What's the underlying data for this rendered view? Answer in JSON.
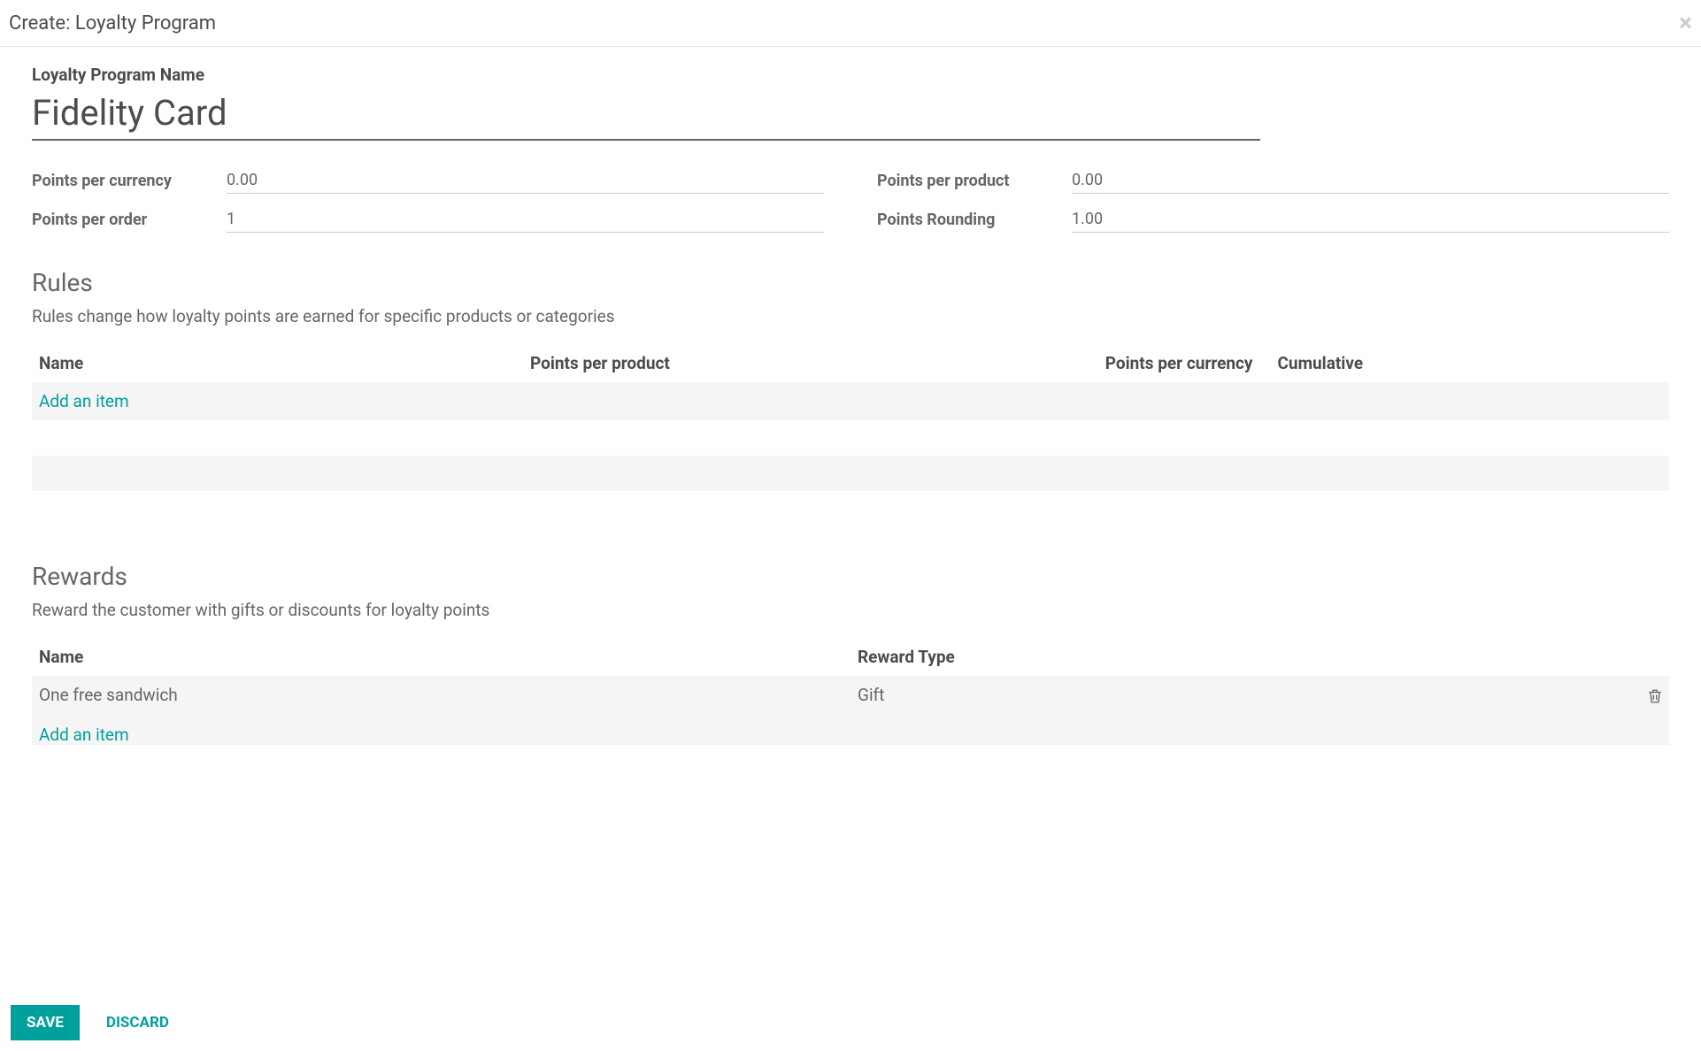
{
  "modal": {
    "title": "Create: Loyalty Program",
    "close_label": "×"
  },
  "form": {
    "name_label": "Loyalty Program Name",
    "name_value": "Fidelity Card",
    "fields": {
      "points_per_currency": {
        "label": "Points per currency",
        "value": "0.00"
      },
      "points_per_order": {
        "label": "Points per order",
        "value": "1"
      },
      "points_per_product": {
        "label": "Points per product",
        "value": "0.00"
      },
      "points_rounding": {
        "label": "Points Rounding",
        "value": "1.00"
      }
    }
  },
  "rules_section": {
    "title": "Rules",
    "desc": "Rules change how loyalty points are earned for specific products or categories",
    "columns": {
      "name": "Name",
      "points_per_product": "Points per product",
      "points_per_currency": "Points per currency",
      "cumulative": "Cumulative"
    },
    "add_item": "Add an item"
  },
  "rewards_section": {
    "title": "Rewards",
    "desc": "Reward the customer with gifts or discounts for loyalty points",
    "columns": {
      "name": "Name",
      "reward_type": "Reward Type"
    },
    "rows": [
      {
        "name": "One free sandwich",
        "reward_type": "Gift"
      }
    ],
    "add_item": "Add an item"
  },
  "footer": {
    "save": "SAVE",
    "discard": "DISCARD"
  }
}
